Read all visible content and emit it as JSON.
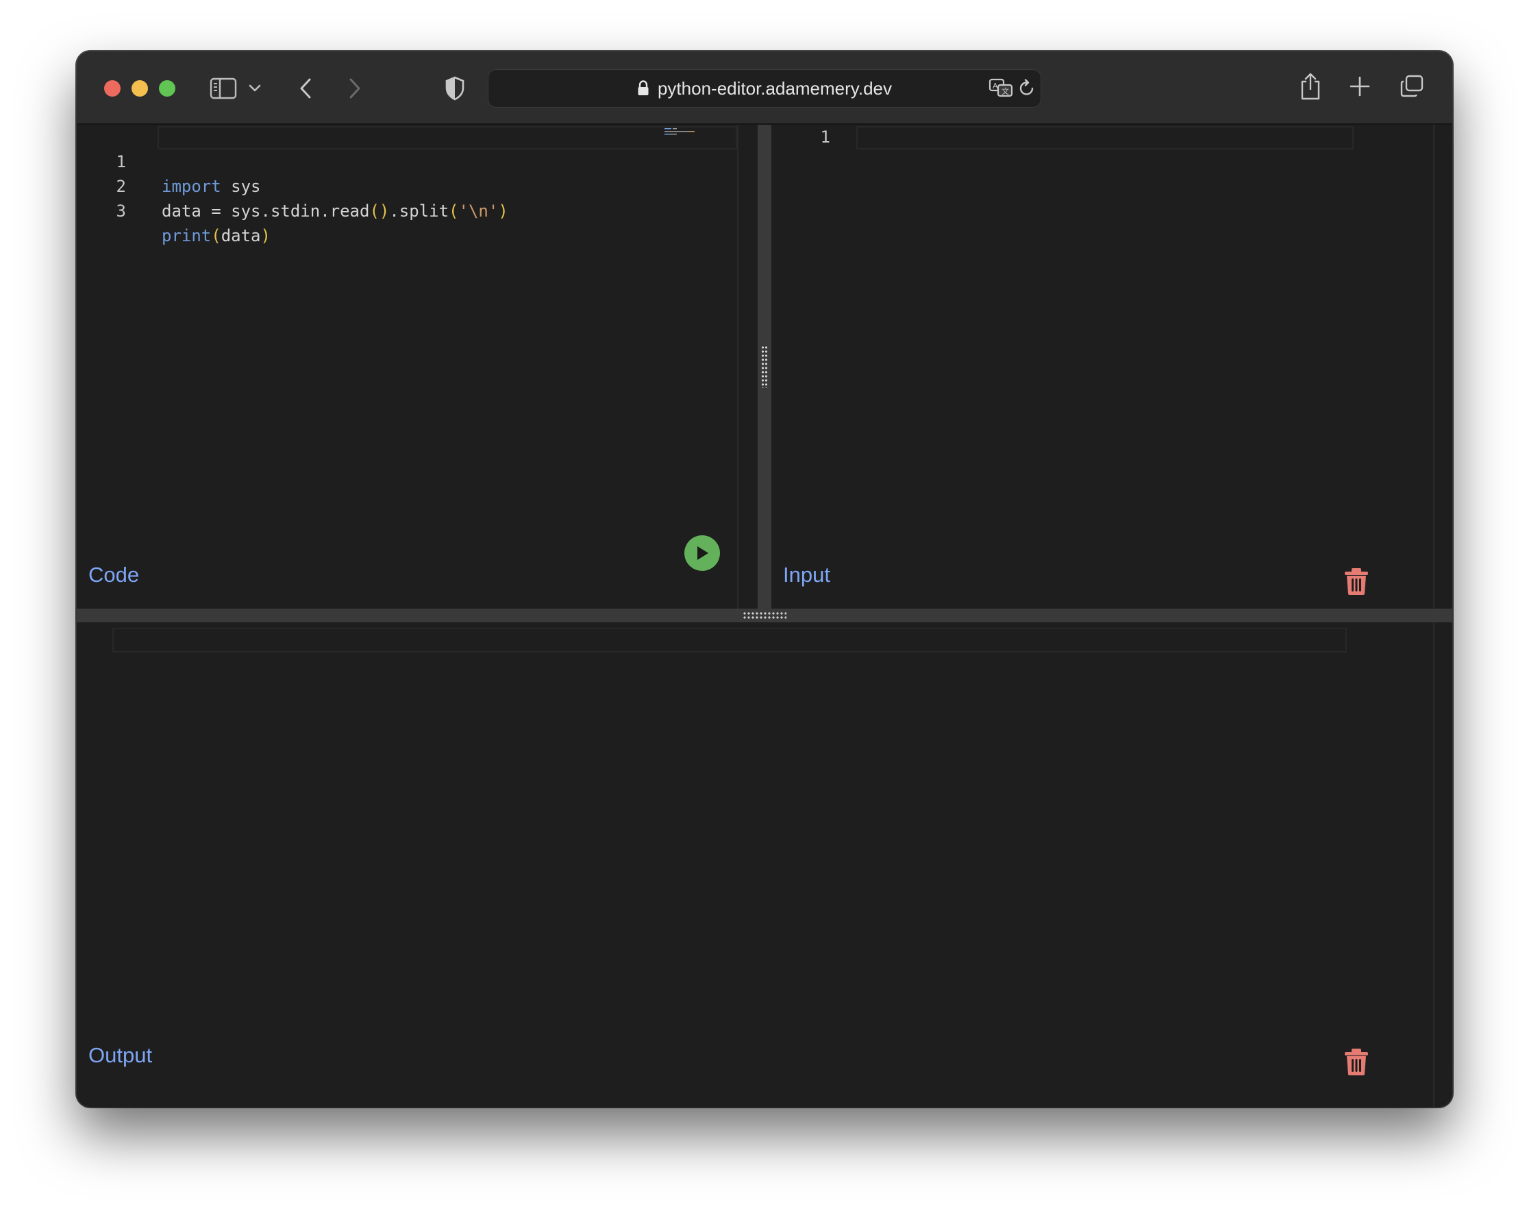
{
  "browser": {
    "url": "python-editor.adamemery.dev",
    "traffic_lights": {
      "close": "#ec6a5e",
      "minimize": "#f4bf4f",
      "zoom": "#61c554"
    }
  },
  "editor": {
    "label": "Code",
    "line_numbers": [
      "1",
      "2",
      "3"
    ],
    "lines": [
      {
        "tokens": [
          {
            "t": "import",
            "c": "kw"
          },
          {
            "t": " sys",
            "c": ""
          }
        ]
      },
      {
        "tokens": [
          {
            "t": "data = sys.stdin.read",
            "c": ""
          },
          {
            "t": "()",
            "c": "br"
          },
          {
            "t": ".split",
            "c": ""
          },
          {
            "t": "(",
            "c": "br"
          },
          {
            "t": "'\\n'",
            "c": "str"
          },
          {
            "t": ")",
            "c": "br"
          }
        ]
      },
      {
        "tokens": [
          {
            "t": "print",
            "c": "kw"
          },
          {
            "t": "(",
            "c": "br"
          },
          {
            "t": "data",
            "c": ""
          },
          {
            "t": ")",
            "c": "br"
          }
        ]
      }
    ]
  },
  "input": {
    "label": "Input",
    "line_numbers": [
      "1"
    ],
    "value": ""
  },
  "output": {
    "label": "Output",
    "value": ""
  },
  "colors": {
    "label": "#7ea6f5",
    "run": "#63b15b",
    "trash": "#e57b73",
    "keyword": "#6f9bd9",
    "bracket": "#e5c14a",
    "string": "#ce9a6a"
  }
}
